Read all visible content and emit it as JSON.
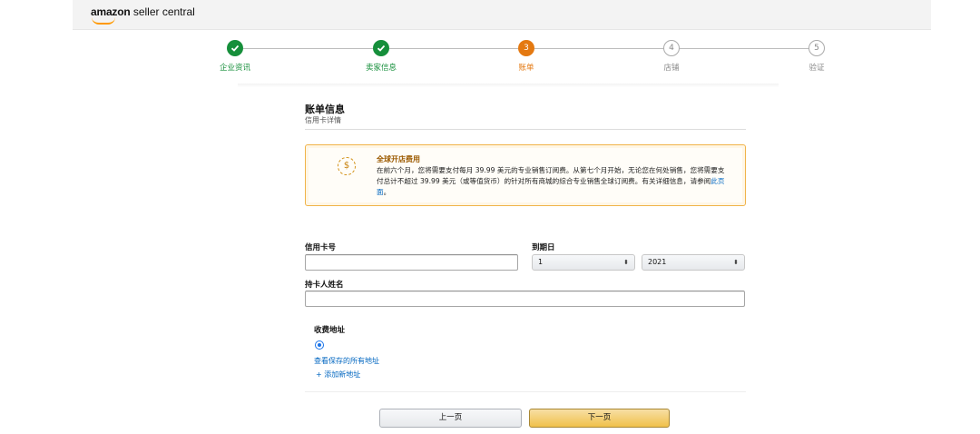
{
  "header": {
    "logo_brand": "amazon",
    "logo_product": " seller central",
    "accent_color": "#ff9900"
  },
  "stepper": {
    "steps": [
      {
        "label": "企业资讯",
        "state": "done",
        "number": ""
      },
      {
        "label": "卖家信息",
        "state": "done",
        "number": ""
      },
      {
        "label": "账单",
        "state": "current",
        "number": "3"
      },
      {
        "label": "店铺",
        "state": "future",
        "number": "4"
      },
      {
        "label": "验证",
        "state": "future",
        "number": "5"
      }
    ],
    "done_color": "#168f3b",
    "current_color": "#e47911"
  },
  "billing": {
    "title": "账单信息",
    "subtitle": "信用卡详情"
  },
  "alert": {
    "icon": "fee-coin-icon",
    "title": "全球开店费用",
    "body_text": "在前六个月，您将需要支付每月 39.99 美元的专业销售订阅费。从第七个月开始，无论您在何处销售，您将需要支付总计不超过 39.99 美元（或等值货币）的针对所有商城的综合专业销售全球订阅费。有关详细信息，请参阅",
    "link_text": "此页面",
    "tail": "。"
  },
  "form": {
    "card_number_label": "信用卡号",
    "card_number_value": "",
    "expiry_label": "到期日",
    "expiry_month": "1",
    "expiry_year": "2021",
    "cardholder_label": "持卡人姓名",
    "cardholder_value": "",
    "billing_address_label": "收费地址",
    "view_addresses_link": "查看保存的所有地址",
    "add_address_link": "+ 添加新地址"
  },
  "buttons": {
    "prev": "上一页",
    "next": "下一页"
  }
}
